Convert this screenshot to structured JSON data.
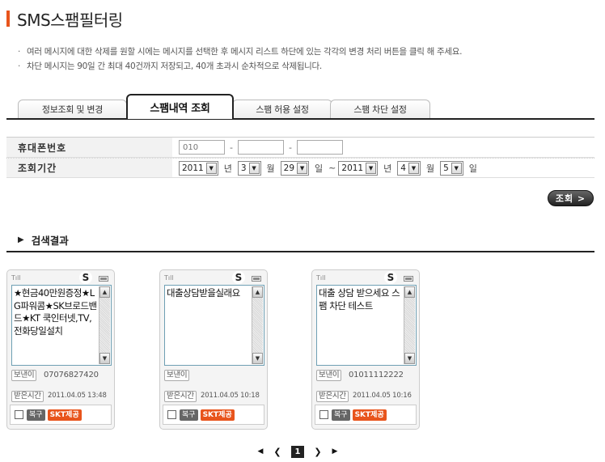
{
  "page": {
    "title": "SMS스팸필터링",
    "notes": [
      "여러 메시지에 대한 삭제를 원할 시에는 메시지를 선택한 후 메시지 리스트 하단에 있는 각각의 변경 처리 버튼을 클릭 해 주세요.",
      "차단 메시지는 90일 간 최대 40건까지 저장되고, 40개 초과시 순차적으로 삭제됩니다."
    ]
  },
  "tabs": [
    "정보조회 및 변경",
    "스팸내역 조회",
    "스팸 허용 설정",
    "스팸 차단 설정"
  ],
  "form": {
    "phone_label": "휴대폰번호",
    "phone_prefix": "010",
    "phone_mid": "",
    "phone_last": "",
    "phone_sep": "-",
    "period_label": "조회기간",
    "from": {
      "year": "2011",
      "month": "3",
      "day": "29"
    },
    "to": {
      "year": "2011",
      "month": "4",
      "day": "5"
    },
    "unit_year": "년",
    "unit_month": "월",
    "unit_day": "일",
    "range_sep": "~",
    "search_button": "조회 >"
  },
  "results": {
    "heading": "검색결과",
    "heading_icon": "chevron-right-icon"
  },
  "cards": [
    {
      "badge": "S",
      "message": "★현금40만원증정★LG파워콤★SK브로드밴드★KT 쿡인터넷,TV,전화당일설치",
      "sender_label": "보낸이",
      "sender": "07076827420",
      "time_label": "받은시간",
      "time": "2011.04.05 13:48",
      "restore": "복구",
      "provider": "SKT제공"
    },
    {
      "badge": "S",
      "message": "대출상담받을실래요",
      "sender_label": "보낸이",
      "sender": "",
      "time_label": "받은시간",
      "time": "2011.04.05 10:18",
      "restore": "복구",
      "provider": "SKT제공"
    },
    {
      "badge": "S",
      "message": "대출 상담 받으세요 스팸 차단 테스트",
      "sender_label": "보낸이",
      "sender": "01011112222",
      "time_label": "받은시간",
      "time": "2011.04.05 10:16",
      "restore": "복구",
      "provider": "SKT제공"
    }
  ],
  "pager": {
    "first": "◀",
    "prev": "❮",
    "current": "1",
    "next": "❯",
    "last": "▶"
  },
  "colors": {
    "accent": "#e8541c",
    "dark": "#222222",
    "screen_border": "#6fa0b4"
  }
}
